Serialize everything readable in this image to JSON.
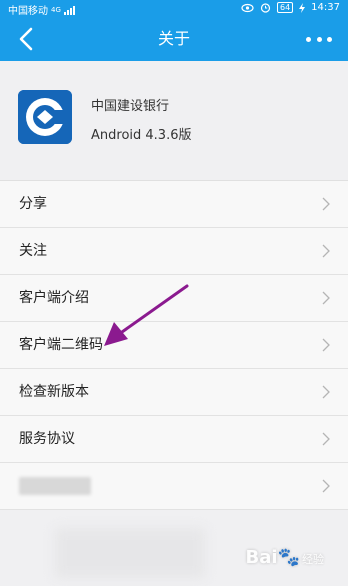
{
  "status_bar": {
    "carrier": "中国移动",
    "network": "4G",
    "battery": "64",
    "time": "14:37"
  },
  "nav": {
    "title": "关于"
  },
  "app": {
    "name": "中国建设银行",
    "version": "Android 4.3.6版"
  },
  "menu": {
    "items": [
      {
        "label": "分享"
      },
      {
        "label": "关注"
      },
      {
        "label": "客户端介绍"
      },
      {
        "label": "客户端二维码"
      },
      {
        "label": "检查新版本"
      },
      {
        "label": "服务协议"
      },
      {
        "label": ""
      }
    ]
  },
  "watermark": {
    "brand": "Bai",
    "suffix": "经验"
  },
  "colors": {
    "header": "#1a9de8",
    "annotation_arrow": "#8b1a8f",
    "logo": "#1566b8"
  },
  "icons": {
    "back": "chevron-left-icon",
    "more": "more-dots-icon",
    "row": "chevron-right-icon"
  }
}
